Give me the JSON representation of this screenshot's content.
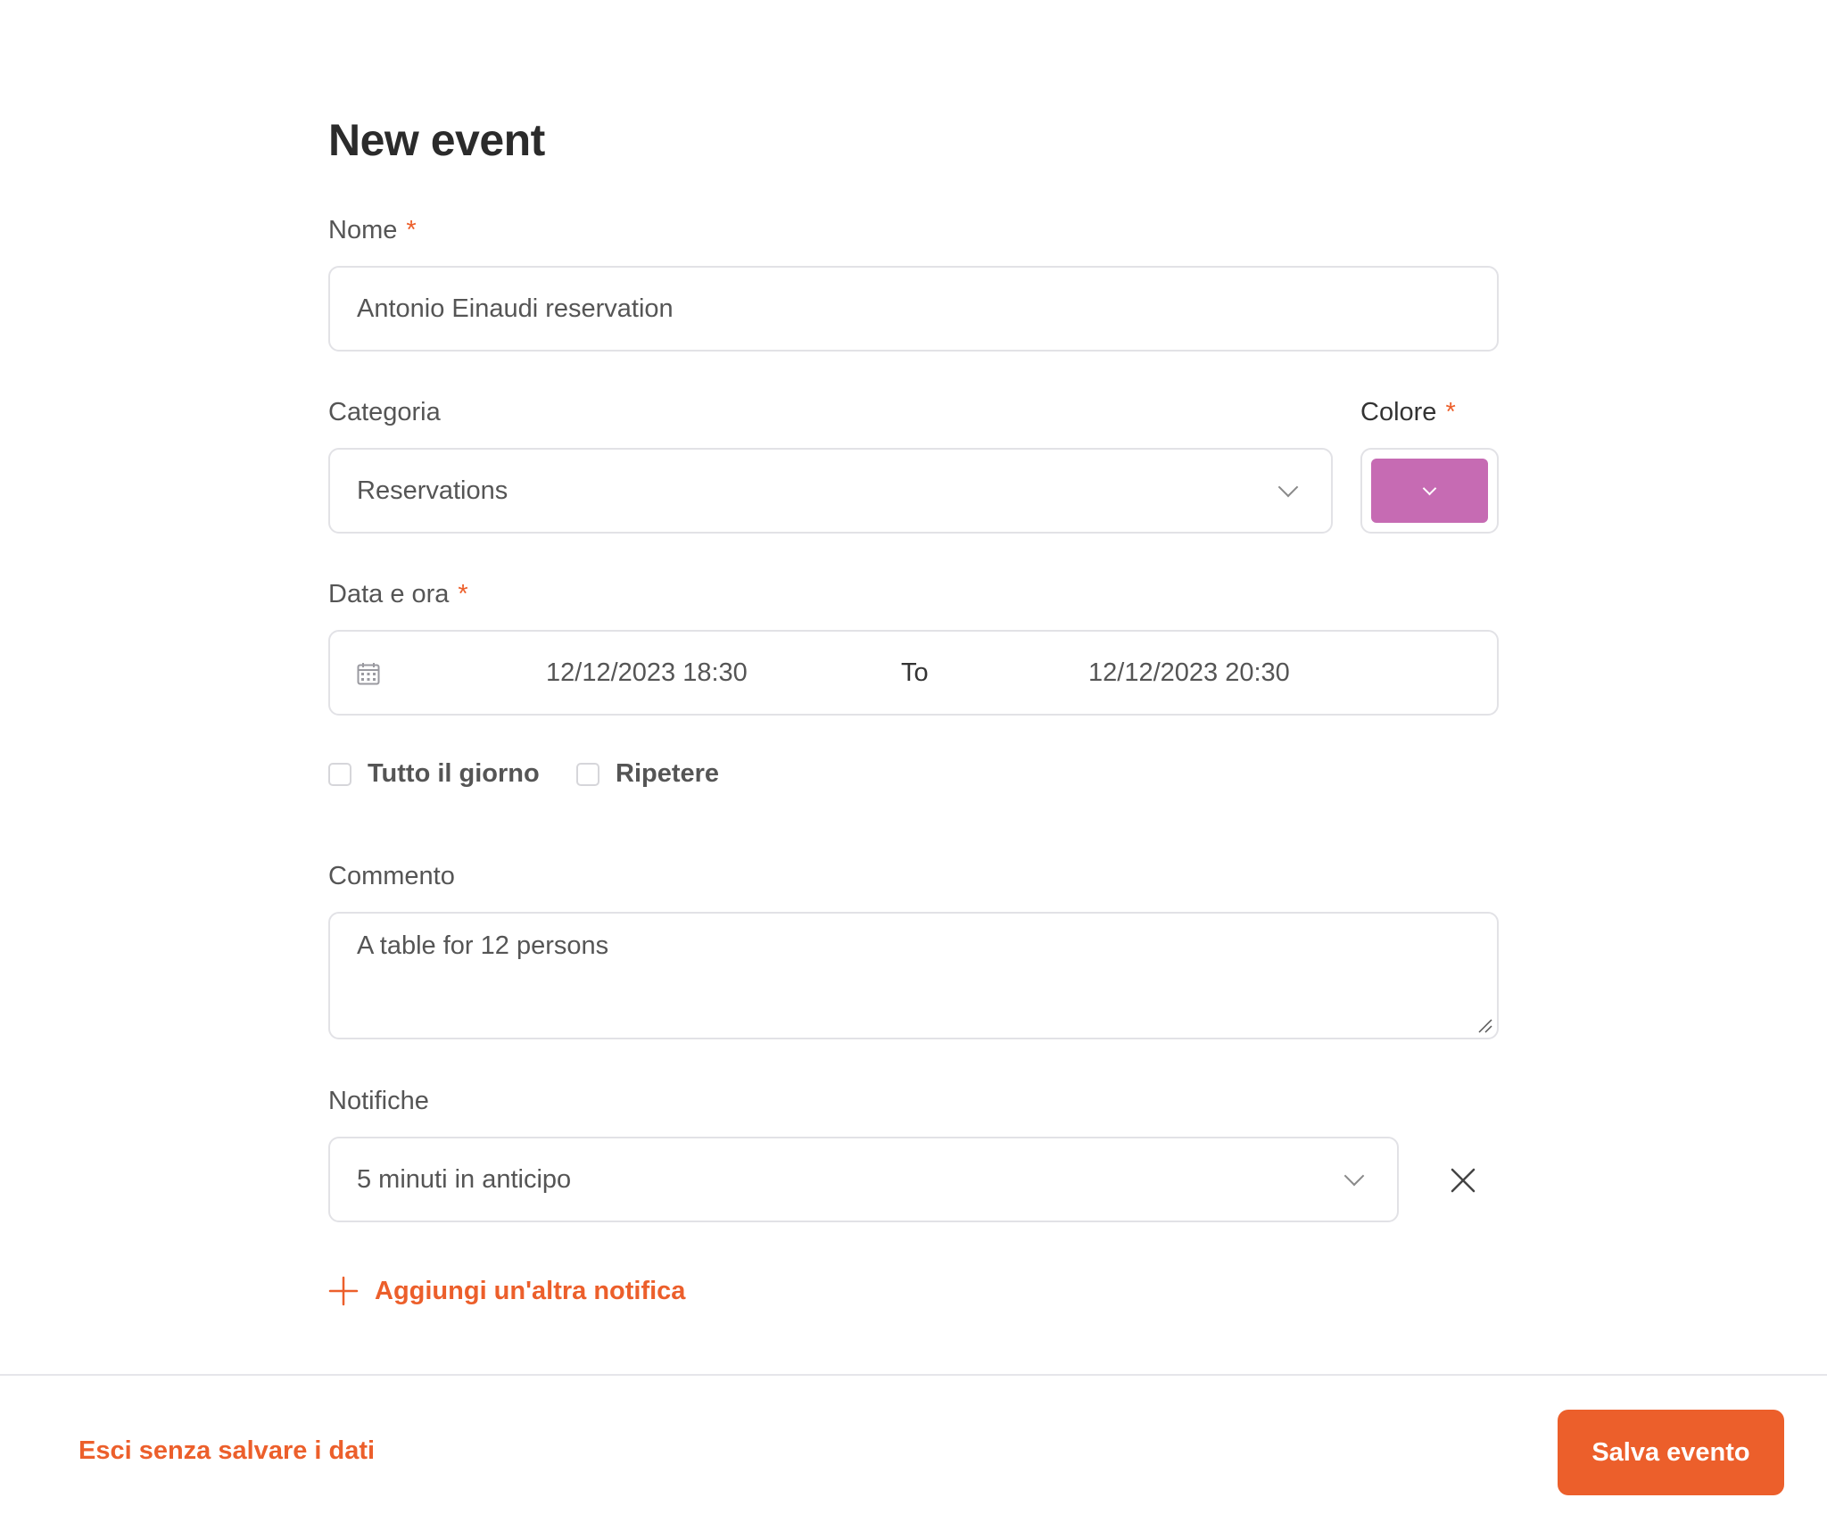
{
  "form": {
    "title": "New event",
    "required_mark": "*",
    "name": {
      "label": "Nome",
      "value": "Antonio Einaudi reservation"
    },
    "category": {
      "label": "Categoria",
      "value": "Reservations"
    },
    "color": {
      "label": "Colore",
      "value": "#c66bb3"
    },
    "datetime": {
      "label": "Data e ora",
      "start": "12/12/2023 18:30",
      "separator": "To",
      "end": "12/12/2023 20:30"
    },
    "all_day": {
      "label": "Tutto il giorno",
      "checked": false
    },
    "repeat": {
      "label": "Ripetere",
      "checked": false
    },
    "comment": {
      "label": "Commento",
      "value": "A table for 12 persons"
    },
    "notifications": {
      "label": "Notifiche",
      "value": "5 minuti in anticipo"
    },
    "add_notification": "Aggiungi un'altra notifica"
  },
  "footer": {
    "exit_label": "Esci senza salvare i dati",
    "save_label": "Salva evento"
  },
  "colors": {
    "accent": "#ec5f2b",
    "border": "#e2e2e6"
  }
}
